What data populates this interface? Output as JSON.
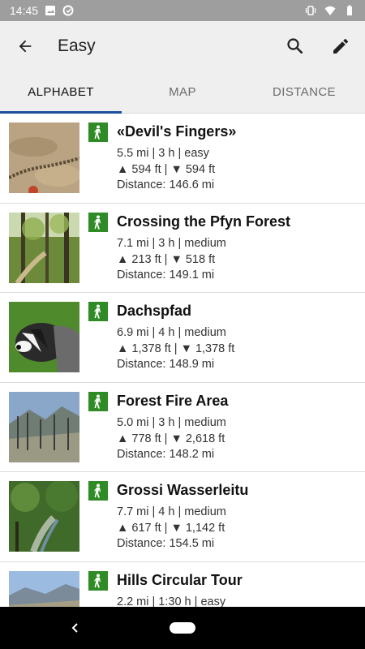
{
  "status": {
    "time": "14:45"
  },
  "app_bar": {
    "title": "Easy"
  },
  "tabs": [
    {
      "label": "ALPHABET"
    },
    {
      "label": "MAP"
    },
    {
      "label": "DISTANCE"
    }
  ],
  "colors": {
    "accent": "#1b4f9c",
    "hike_badge": "#2e8b25",
    "status_bar": "#9e9e9e",
    "app_bar": "#efefef"
  },
  "trails": [
    {
      "title": "«Devil's Fingers»",
      "stats": "5.5 mi | 3 h | easy",
      "elevation": "▲ 594 ft | ▼ 594 ft",
      "distance": "Distance: 146.6 mi"
    },
    {
      "title": "Crossing the Pfyn Forest",
      "stats": "7.1 mi | 3 h | medium",
      "elevation": "▲ 213 ft | ▼ 518 ft",
      "distance": "Distance: 149.1 mi"
    },
    {
      "title": "Dachspfad",
      "stats": "6.9 mi | 4 h | medium",
      "elevation": "▲ 1,378 ft | ▼ 1,378 ft",
      "distance": "Distance: 148.9 mi"
    },
    {
      "title": "Forest Fire Area",
      "stats": "5.0 mi | 3 h | medium",
      "elevation": "▲ 778 ft | ▼ 2,618 ft",
      "distance": "Distance: 148.2 mi"
    },
    {
      "title": "Grossi Wasserleitu",
      "stats": "7.7 mi | 4 h | medium",
      "elevation": "▲ 617 ft | ▼ 1,142 ft",
      "distance": "Distance: 154.5 mi"
    },
    {
      "title": "Hills Circular Tour",
      "stats": "2.2 mi | 1:30 h | easy",
      "elevation": "",
      "distance": ""
    }
  ]
}
